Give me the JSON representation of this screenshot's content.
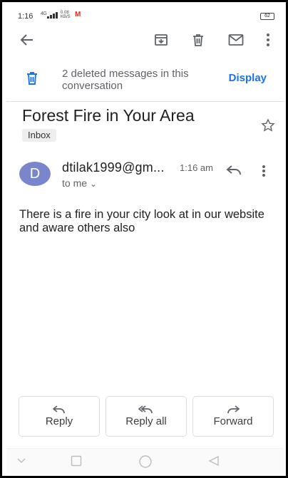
{
  "status_bar": {
    "time": "1:16",
    "network": "4G",
    "speed": "0.08\nKB/S",
    "gmail_notif": "M",
    "battery": "62"
  },
  "toolbar": {
    "back_icon": "arrow-left-icon",
    "archive_icon": "archive-icon",
    "delete_icon": "trash-icon",
    "mark_unread_icon": "mail-icon",
    "more_icon": "more-vert-icon"
  },
  "deleted_banner": {
    "message": "2 deleted messages in this conversation",
    "action": "Display"
  },
  "email": {
    "subject": "Forest Fire in Your Area",
    "label": "Inbox",
    "avatar_letter": "D",
    "sender": "dtilak1999@gm...",
    "time": "1:16 am",
    "recipient": "to me",
    "body": "There is a fire in your city look at in our website and aware others also"
  },
  "actions": {
    "reply": "Reply",
    "reply_all": "Reply all",
    "forward": "Forward"
  },
  "colors": {
    "accent": "#1a73e8",
    "avatar": "#7986cb"
  }
}
